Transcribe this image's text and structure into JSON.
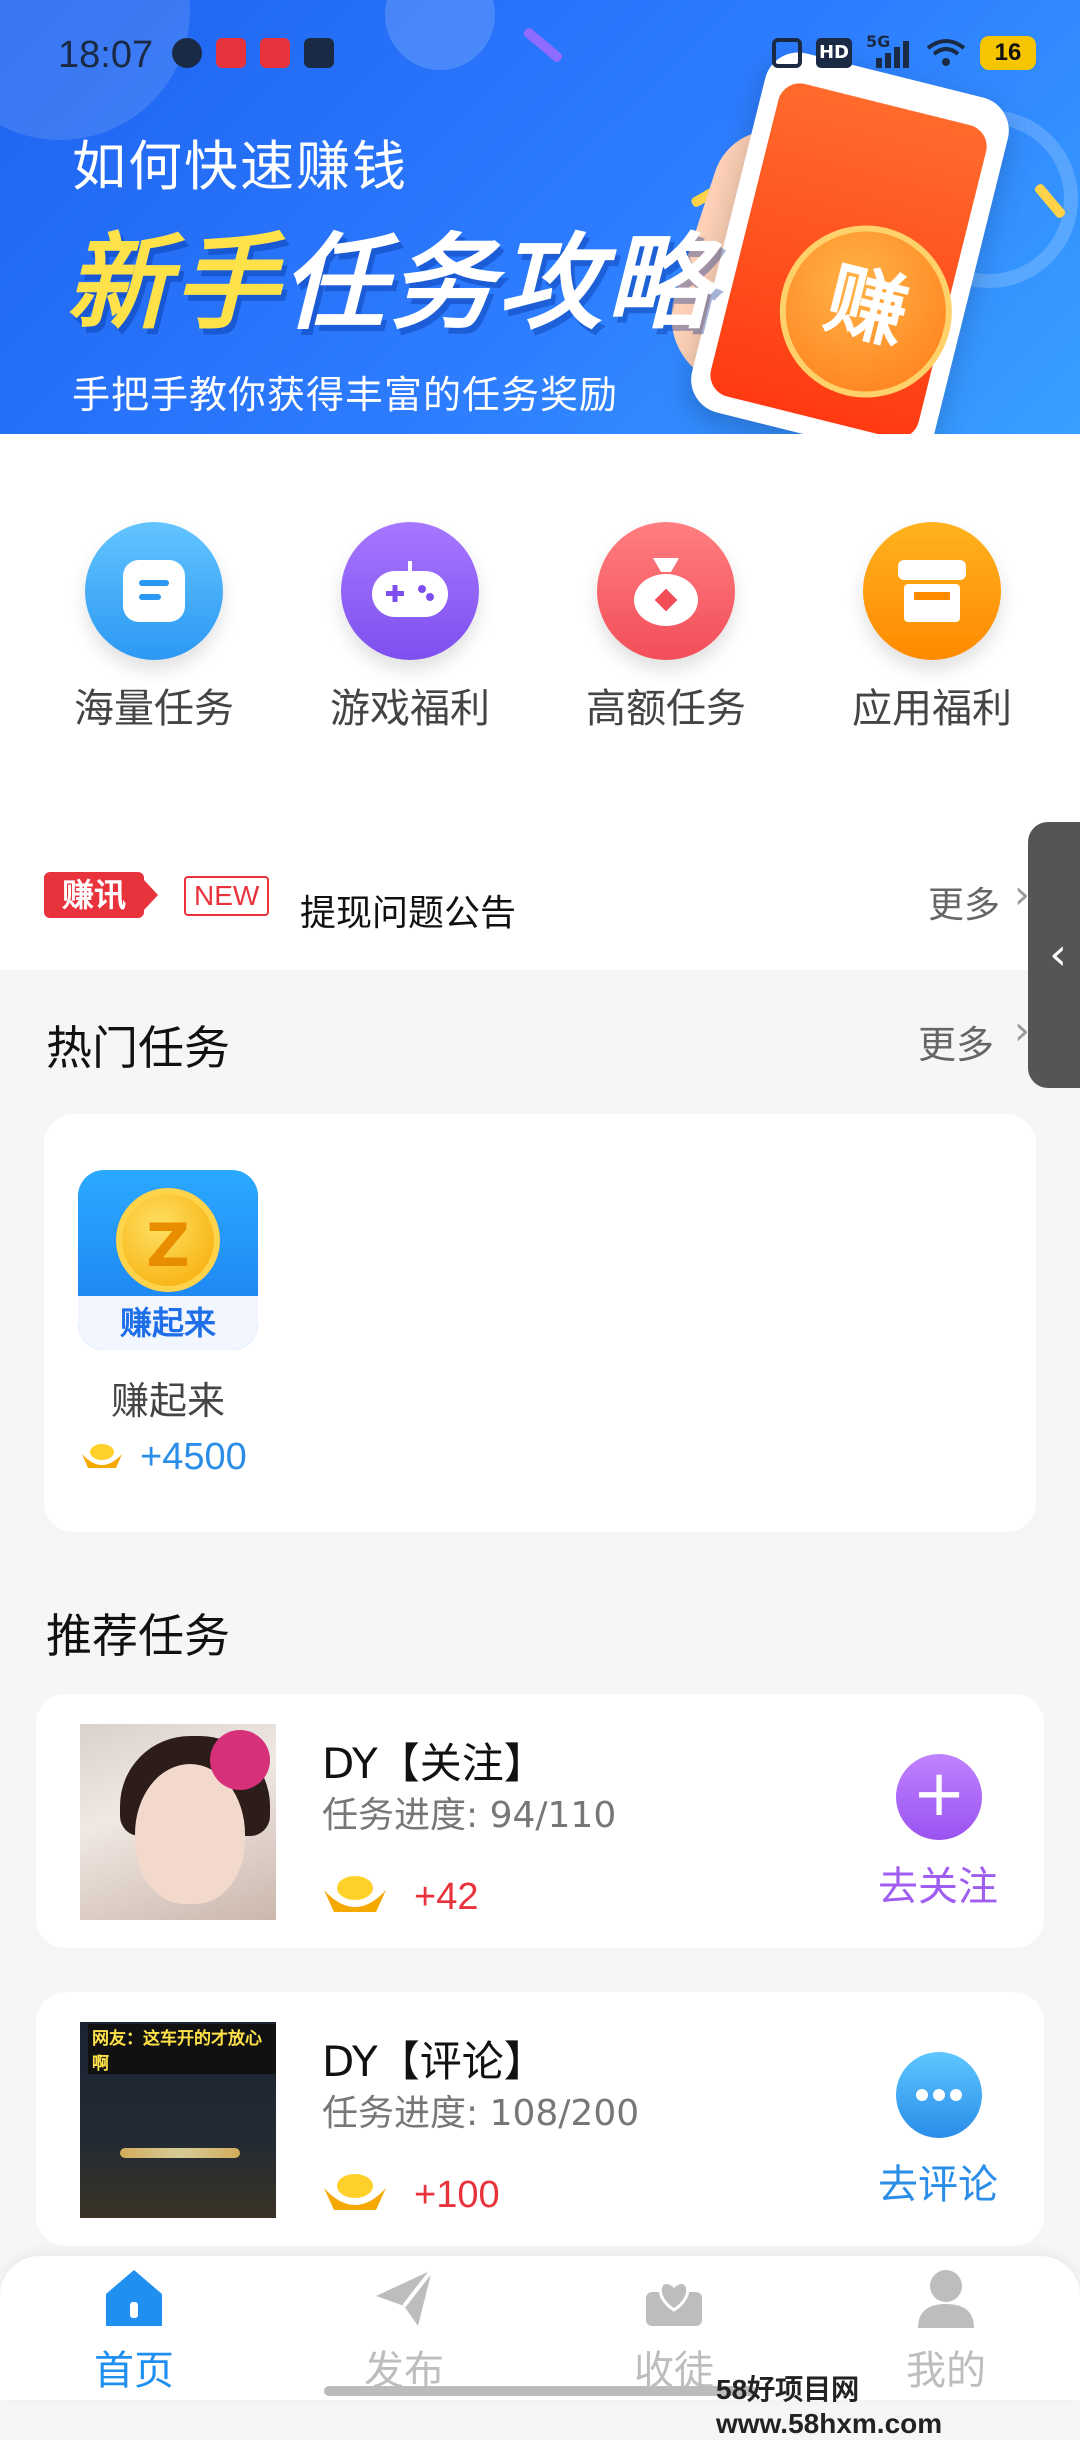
{
  "status_bar": {
    "time": "18:07",
    "battery": "16",
    "network": "5G",
    "hd": "HD",
    "left_icons": [
      "wechat-icon",
      "pinduoduo-icon",
      "video-app-icon",
      "calendar-icon"
    ],
    "right_icons": [
      "vibrate-icon",
      "hd-icon",
      "signal-icon",
      "wifi-icon",
      "battery-icon"
    ]
  },
  "banner": {
    "line1": "如何快速赚钱",
    "line2_a": "新手",
    "line2_b": "任务攻略",
    "line3": "手把手教你获得丰富的任务奖励",
    "coin_text": "赚"
  },
  "categories": [
    {
      "label": "海量任务",
      "icon": "task-list-icon",
      "color": "#2b98f3"
    },
    {
      "label": "游戏福利",
      "icon": "gamepad-icon",
      "color": "#7d4fef"
    },
    {
      "label": "高额任务",
      "icon": "money-bag-icon",
      "color": "#f24e59"
    },
    {
      "label": "应用福利",
      "icon": "store-icon",
      "color": "#ff8a00"
    }
  ],
  "notice": {
    "tag": "赚讯",
    "new_tag": "NEW",
    "text": "提现问题公告",
    "more": "更多"
  },
  "hot_tasks": {
    "title": "热门任务",
    "more": "更多",
    "items": [
      {
        "name": "赚起来",
        "reward": "+4500",
        "icon_letter": "Z",
        "icon_caption": "赚起来"
      }
    ]
  },
  "recommended": {
    "title": "推荐任务",
    "items": [
      {
        "title": "DY【关注】",
        "progress": "任务进度: 94/110",
        "reward": "+42",
        "action": "去关注",
        "action_color": "#a05ef0",
        "thumb_caption": ""
      },
      {
        "title": "DY【评论】",
        "progress": "任务进度: 108/200",
        "reward": "+100",
        "action": "去评论",
        "action_color": "#2a8de8",
        "thumb_caption": "网友：这车开的才放心啊"
      }
    ]
  },
  "bottom_nav": {
    "active_color": "#1f8ff0",
    "inactive_color": "#bdbdbd",
    "items": [
      {
        "label": "首页",
        "icon": "home-icon",
        "active": true
      },
      {
        "label": "发布",
        "icon": "paper-plane-icon",
        "active": false
      },
      {
        "label": "收徒",
        "icon": "heart-envelope-icon",
        "active": false
      },
      {
        "label": "我的",
        "icon": "user-icon",
        "active": false
      }
    ]
  },
  "watermark": "58好项目网www.58hxm.com"
}
